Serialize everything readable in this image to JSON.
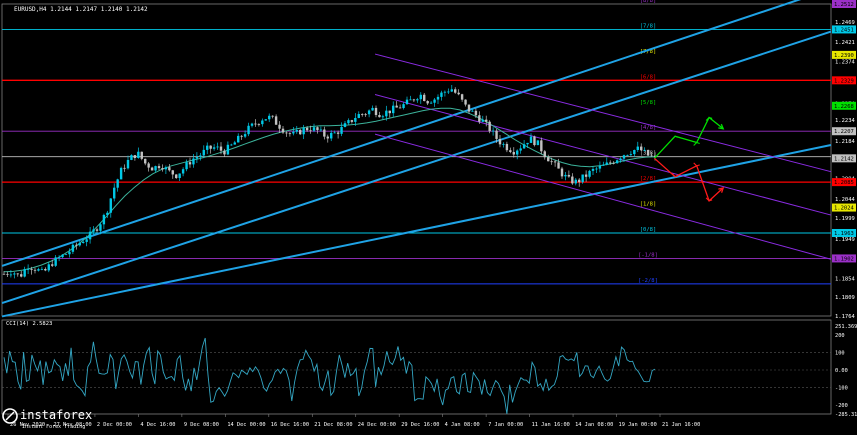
{
  "header": {
    "symbol_line": "EURUSD,H4  1.2144 1.2147 1.2140 1.2142"
  },
  "colors": {
    "background": "#000000",
    "bull": "#00c8e6",
    "bear": "#c1c1c1",
    "frame": "#808080",
    "ma": "#3cb39b",
    "channel": "#1fa3e6",
    "murray_red": "#ff0000",
    "murray_purple": "#9b30c8",
    "murray_cyan": "#00c8e6",
    "regression": "#8a2be2",
    "up_arrow": "#00e000",
    "down_arrow": "#ff1a1a",
    "cci": "#34a7c4"
  },
  "chart_data": [
    {
      "type": "candlestick",
      "title": "EURUSD,H4",
      "ylim": [
        1.1764,
        1.2512
      ],
      "y_ticks": [
        "1.2512",
        "1.2469",
        "1.2421",
        "1.2374",
        "1.2329",
        "1.2274",
        "1.2234",
        "1.2184",
        "1.2139",
        "1.2094",
        "1.2044",
        "1.1999",
        "1.1949",
        "1.1904",
        "1.1854",
        "1.1809",
        "1.1764"
      ],
      "x_ticks": [
        "26 Nov 2020",
        "27 Nov 08:00",
        "2 Dec 00:00",
        "4 Dec 16:00",
        "9 Dec 08:00",
        "14 Dec 00:00",
        "16 Dec 16:00",
        "21 Dec 08:00",
        "24 Dec 00:00",
        "29 Dec 16:00",
        "4 Jan 08:00",
        "7 Jan 00:00",
        "11 Jan 16:00",
        "14 Jan 08:00",
        "19 Jan 00:00",
        "21 Jan 16:00"
      ],
      "price_tags": [
        {
          "label": "1.2512",
          "value": 1.2512,
          "color": "#9b30c8"
        },
        {
          "label": "1.2451",
          "value": 1.2451,
          "color": "#00c8e6"
        },
        {
          "label": "1.2390",
          "value": 1.239,
          "color": "#e6e600"
        },
        {
          "label": "1.2329",
          "value": 1.2329,
          "color": "#ff0000"
        },
        {
          "label": "1.2268",
          "value": 1.2268,
          "color": "#00e000"
        },
        {
          "label": "1.2207",
          "value": 1.2207,
          "color": "#c0c0c0"
        },
        {
          "label": "1.2142",
          "value": 1.2142,
          "color": "#c0c0c0"
        },
        {
          "label": "1.2085",
          "value": 1.2085,
          "color": "#ff0000"
        },
        {
          "label": "1.2024",
          "value": 1.2024,
          "color": "#e6e600"
        },
        {
          "label": "1.1963",
          "value": 1.1963,
          "color": "#00c8e6"
        },
        {
          "label": "1.1902",
          "value": 1.1902,
          "color": "#9b30c8"
        }
      ],
      "murray_levels": [
        {
          "label": "[8/8]",
          "value": 1.2512,
          "color": "#9b30c8",
          "line": false
        },
        {
          "label": "[7/8]",
          "value": 1.2451,
          "color": "#00c8e6",
          "line": true
        },
        {
          "label": "[7/8]",
          "value": 1.239,
          "color": "#e6e600",
          "line": false
        },
        {
          "label": "[6/8]",
          "value": 1.2329,
          "color": "#ff0000",
          "line": true
        },
        {
          "label": "[5/8]",
          "value": 1.2268,
          "color": "#00e000",
          "line": false
        },
        {
          "label": "[4/8]",
          "value": 1.2207,
          "color": "#9b30c8",
          "line": true
        },
        {
          "label": "[3/8]",
          "value": 1.2146,
          "color": "#c0c0c0",
          "line": true
        },
        {
          "label": "[2/8]",
          "value": 1.2085,
          "color": "#ff0000",
          "line": true
        },
        {
          "label": "[1/8]",
          "value": 1.2024,
          "color": "#e6e600",
          "line": false
        },
        {
          "label": "[0/8]",
          "value": 1.1963,
          "color": "#00c8e6",
          "line": true
        },
        {
          "label": "[-1/8]",
          "value": 1.1902,
          "color": "#9b30c8",
          "line": true
        },
        {
          "label": "[-2/8]",
          "value": 1.1841,
          "color": "#2040ff",
          "line": true
        }
      ],
      "close_path": [
        1.1865,
        1.1872,
        1.1858,
        1.1885,
        1.1878,
        1.1866,
        1.189,
        1.1903,
        1.1914,
        1.193,
        1.1945,
        1.1958,
        1.198,
        1.201,
        1.207,
        1.2115,
        1.214,
        1.2155,
        1.213,
        1.2118,
        1.2128,
        1.211,
        1.2102,
        1.212,
        1.214,
        1.215,
        1.2165,
        1.2168,
        1.2158,
        1.2172,
        1.219,
        1.221,
        1.2225,
        1.2238,
        1.224,
        1.2222,
        1.2205,
        1.2198,
        1.221,
        1.2215,
        1.2208,
        1.2195,
        1.22,
        1.2212,
        1.2228,
        1.2245,
        1.225,
        1.226,
        1.2248,
        1.2255,
        1.2262,
        1.227,
        1.2282,
        1.2296,
        1.228,
        1.2285,
        1.23,
        1.231,
        1.229,
        1.2262,
        1.2248,
        1.2232,
        1.221,
        1.2185,
        1.217,
        1.216,
        1.2172,
        1.219,
        1.2178,
        1.215,
        1.213,
        1.2108,
        1.209,
        1.2085,
        1.2098,
        1.2112,
        1.212,
        1.2128,
        1.214,
        1.2152,
        1.216,
        1.2165,
        1.215,
        1.2142
      ],
      "moving_average": [
        1.187,
        1.1871,
        1.1874,
        1.1879,
        1.1886,
        1.1895,
        1.1906,
        1.192,
        1.1936,
        1.1955,
        1.1978,
        1.2002,
        1.2028,
        1.2052,
        1.2072,
        1.209,
        1.2105,
        1.2116,
        1.2124,
        1.213,
        1.2136,
        1.2141,
        1.2147,
        1.2154,
        1.2161,
        1.2169,
        1.2177,
        1.2185,
        1.2193,
        1.22,
        1.2206,
        1.2211,
        1.2215,
        1.2218,
        1.222,
        1.222,
        1.2221,
        1.2222,
        1.2224,
        1.2227,
        1.2231,
        1.2236,
        1.2241,
        1.2246,
        1.2251,
        1.2256,
        1.226,
        1.2262,
        1.2262,
        1.2258,
        1.225,
        1.224,
        1.2228,
        1.2214,
        1.22,
        1.2186,
        1.2173,
        1.2161,
        1.215,
        1.214,
        1.2132,
        1.2126,
        1.2123,
        1.2122,
        1.2124,
        1.2128,
        1.2133,
        1.2138,
        1.2142,
        1.2145,
        1.2146
      ],
      "channel_lines": [
        {
          "from": [
            0,
            1.1884
          ],
          "to": [
            1,
            1.2548
          ]
        },
        {
          "from": [
            0,
            1.1795
          ],
          "to": [
            1,
            1.2446
          ]
        },
        {
          "from": [
            0,
            1.1763
          ],
          "to": [
            1,
            1.2174
          ]
        }
      ],
      "regression_lines": [
        {
          "from": [
            0.45,
            1.2392
          ],
          "to": [
            1,
            1.211
          ]
        },
        {
          "from": [
            0.45,
            1.2295
          ],
          "to": [
            1,
            1.2006
          ]
        },
        {
          "from": [
            0.45,
            1.22
          ],
          "to": [
            1,
            1.19
          ]
        }
      ],
      "forecast_up": [
        [
          0.787,
          1.2142
        ],
        [
          0.812,
          1.2195
        ],
        [
          0.838,
          1.218
        ],
        [
          0.853,
          1.224
        ],
        [
          0.87,
          1.2213
        ]
      ],
      "forecast_down": [
        [
          0.787,
          1.2142
        ],
        [
          0.812,
          1.2098
        ],
        [
          0.838,
          1.2124
        ],
        [
          0.853,
          1.204
        ],
        [
          0.87,
          1.2071
        ]
      ]
    },
    {
      "type": "line",
      "title": "CCI(14) 2.5823",
      "ylim": [
        -250,
        250
      ],
      "y_ticks": [
        "251.3696",
        "200",
        "100",
        "0.00",
        "-100",
        "-200",
        "-285.3113"
      ],
      "values": [
        72,
        -18,
        108,
        48,
        44,
        -66,
        -110,
        102,
        -64,
        -57,
        86,
        34,
        -5,
        54,
        -84,
        48,
        -16,
        -7,
        58,
        32,
        20,
        -62,
        38,
        -33,
        126,
        -57,
        -88,
        -100,
        -118,
        -146,
        18,
        46,
        160,
        60,
        -18,
        -22,
        -24,
        -16,
        88,
        60,
        -108,
        -14,
        64,
        86,
        50,
        -8,
        -45,
        48,
        46,
        -83,
        28,
        100,
        128,
        -20,
        -80,
        108,
        84,
        -12,
        -51,
        -42,
        -37,
        -59,
        60,
        82,
        -45,
        -116,
        -50,
        -120,
        12,
        -56,
        42,
        132,
        182,
        -28,
        -183,
        -177,
        -121,
        -101,
        -124,
        -149,
        -118,
        -65,
        -16,
        -27,
        -44,
        -1,
        -12,
        -25,
        12,
        -9,
        18,
        -4,
        -45,
        -102,
        -120,
        -79,
        -58,
        -12,
        4,
        -20,
        9,
        -4,
        -57,
        -176,
        -69,
        10,
        58,
        60,
        112,
        81,
        58,
        -6,
        32,
        -92,
        -116,
        -62,
        -3,
        -144,
        -122,
        -7,
        86,
        27,
        -44,
        39,
        -32,
        -20,
        8,
        -148,
        -104,
        -8,
        46,
        123,
        122,
        -96,
        16,
        -26,
        24,
        106,
        46,
        31,
        68,
        134,
        55,
        72,
        -20,
        47,
        26,
        -174,
        -163,
        -163,
        -166,
        -39,
        -55,
        -78,
        -121,
        -50,
        -149,
        -199,
        -115,
        -106,
        -46,
        -38,
        -123,
        -136,
        -30,
        -18,
        -122,
        -127,
        -15,
        -40,
        -63,
        -139,
        -54,
        -128,
        -145,
        -99,
        -60,
        -77,
        -118,
        -150,
        -249,
        -84,
        -184,
        -123,
        -82,
        -44,
        -56,
        -58,
        -75,
        44,
        14,
        -92,
        -78,
        -116,
        -50,
        -115,
        -95,
        -83,
        -36,
        75,
        82,
        62,
        55,
        63,
        53,
        100,
        -37,
        -17,
        24,
        22,
        -31,
        -44,
        -4,
        22,
        -17,
        -51,
        -63,
        -49,
        10,
        75,
        22,
        130,
        114,
        58,
        47,
        50,
        9,
        -8,
        -36,
        -64,
        -67,
        -65,
        -3,
        5
      ]
    }
  ],
  "brand": {
    "name": "instaforex",
    "tagline": "Instant Forex Trading"
  }
}
